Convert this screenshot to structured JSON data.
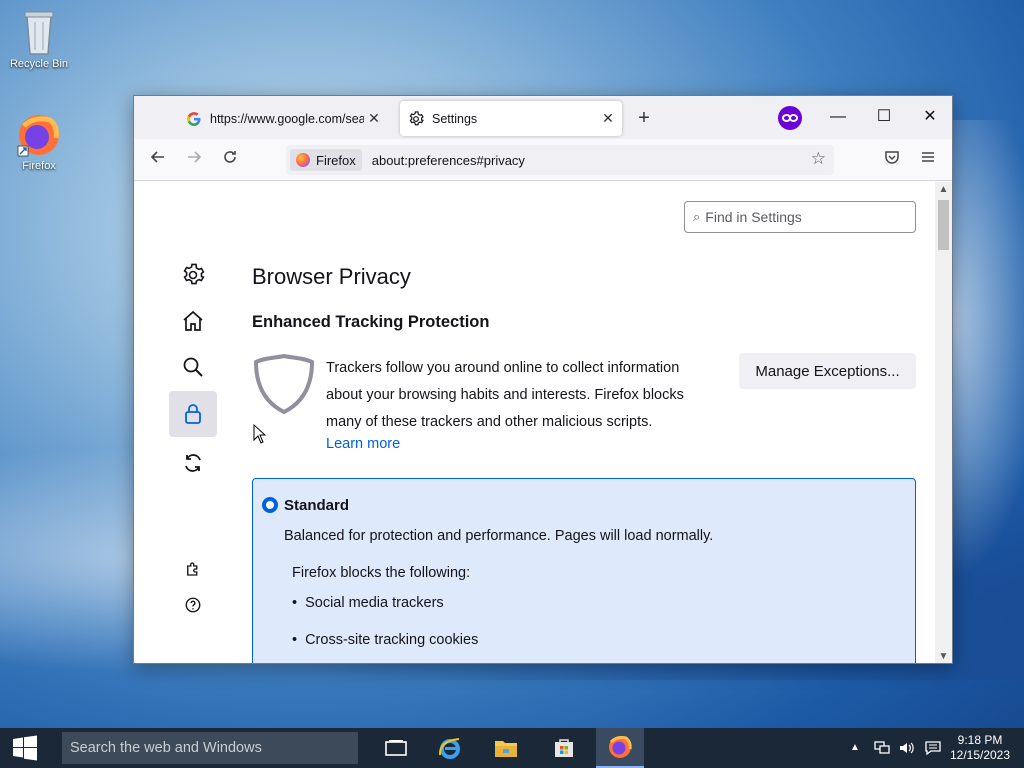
{
  "desktop": {
    "icons": [
      {
        "label": "Recycle Bin"
      },
      {
        "label": "Firefox"
      }
    ]
  },
  "browser": {
    "tabs": [
      {
        "title": "https://www.google.com/search",
        "active": false
      },
      {
        "title": "Settings",
        "active": true
      }
    ],
    "new_tab_label": "+",
    "window_controls": {
      "minimize": "—",
      "maximize": "☐",
      "close": "✕"
    },
    "identity_label": "Firefox",
    "url": "about:preferences#privacy"
  },
  "settings": {
    "search_placeholder": "Find in Settings",
    "page_title": "Browser Privacy",
    "etp_heading": "Enhanced Tracking Protection",
    "etp_description": "Trackers follow you around online to collect information about your browsing habits and interests. Firefox blocks many of these trackers and other malicious scripts.",
    "learn_more": "Learn more",
    "manage_exceptions": "Manage Exceptions...",
    "standard": {
      "title": "Standard",
      "description": "Balanced for protection and performance. Pages will load normally.",
      "blocks_heading": "Firefox blocks the following:",
      "items": [
        "Social media trackers",
        "Cross-site tracking cookies"
      ]
    }
  },
  "taskbar": {
    "search_placeholder": "Search the web and Windows",
    "time": "9:18 PM",
    "date": "12/15/2023"
  },
  "colors": {
    "accent": "#0061e0",
    "standard_bg": "#deeafc",
    "taskbar": "#1b2838"
  }
}
